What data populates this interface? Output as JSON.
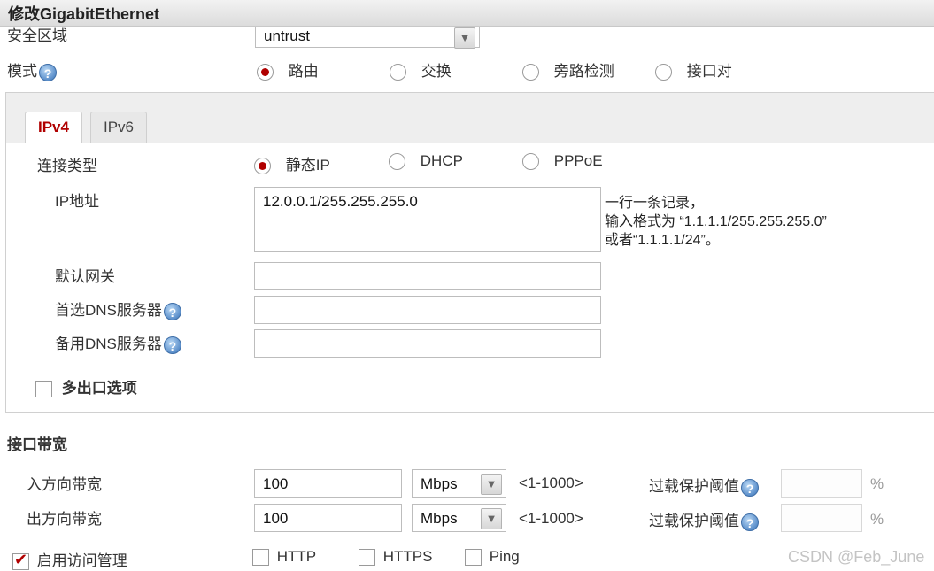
{
  "window": {
    "title": "修改GigabitEthernet"
  },
  "zone": {
    "label": "安全区域",
    "value": "untrust"
  },
  "mode": {
    "label": "模式",
    "options": [
      {
        "label": "路由",
        "selected": true
      },
      {
        "label": "交换",
        "selected": false
      },
      {
        "label": "旁路检测",
        "selected": false
      },
      {
        "label": "接口对",
        "selected": false
      }
    ]
  },
  "tabs": [
    {
      "label": "IPv4",
      "active": true
    },
    {
      "label": "IPv6",
      "active": false
    }
  ],
  "ipv4": {
    "conn_type_label": "连接类型",
    "conn_options": [
      {
        "label": "静态IP",
        "selected": true
      },
      {
        "label": "DHCP",
        "selected": false
      },
      {
        "label": "PPPoE",
        "selected": false
      }
    ],
    "ip_label": "IP地址",
    "ip_value": "12.0.0.1/255.255.255.0",
    "ip_hint": [
      "一行一条记录，",
      "输入格式为 “1.1.1.1/255.255.255.0”",
      "或者“1.1.1.1/24”。"
    ],
    "gateway_label": "默认网关",
    "gateway_value": "",
    "dns1_label": "首选DNS服务器",
    "dns1_value": "",
    "dns2_label": "备用DNS服务器",
    "dns2_value": "",
    "multi_exit_label": "多出口选项",
    "multi_exit_checked": false
  },
  "bandwidth": {
    "section_title": "接口带宽",
    "rows": [
      {
        "label": "入方向带宽",
        "value": "100",
        "unit": "Mbps",
        "range": "<1-1000>",
        "overload_label": "过载保护阈值",
        "overload_value": "",
        "percent": "%"
      },
      {
        "label": "出方向带宽",
        "value": "100",
        "unit": "Mbps",
        "range": "<1-1000>",
        "overload_label": "过载保护阈值",
        "overload_value": "",
        "percent": "%"
      }
    ]
  },
  "access": {
    "label": "启用访问管理",
    "checked": true,
    "options": [
      {
        "label": "HTTP",
        "checked": false
      },
      {
        "label": "HTTPS",
        "checked": false
      },
      {
        "label": "Ping",
        "checked": false
      }
    ]
  },
  "watermark": "CSDN @Feb_June",
  "colors": {
    "accent": "#b00000",
    "help_icon": "#5b8fcb",
    "tab_bg": "#eeeeee"
  }
}
